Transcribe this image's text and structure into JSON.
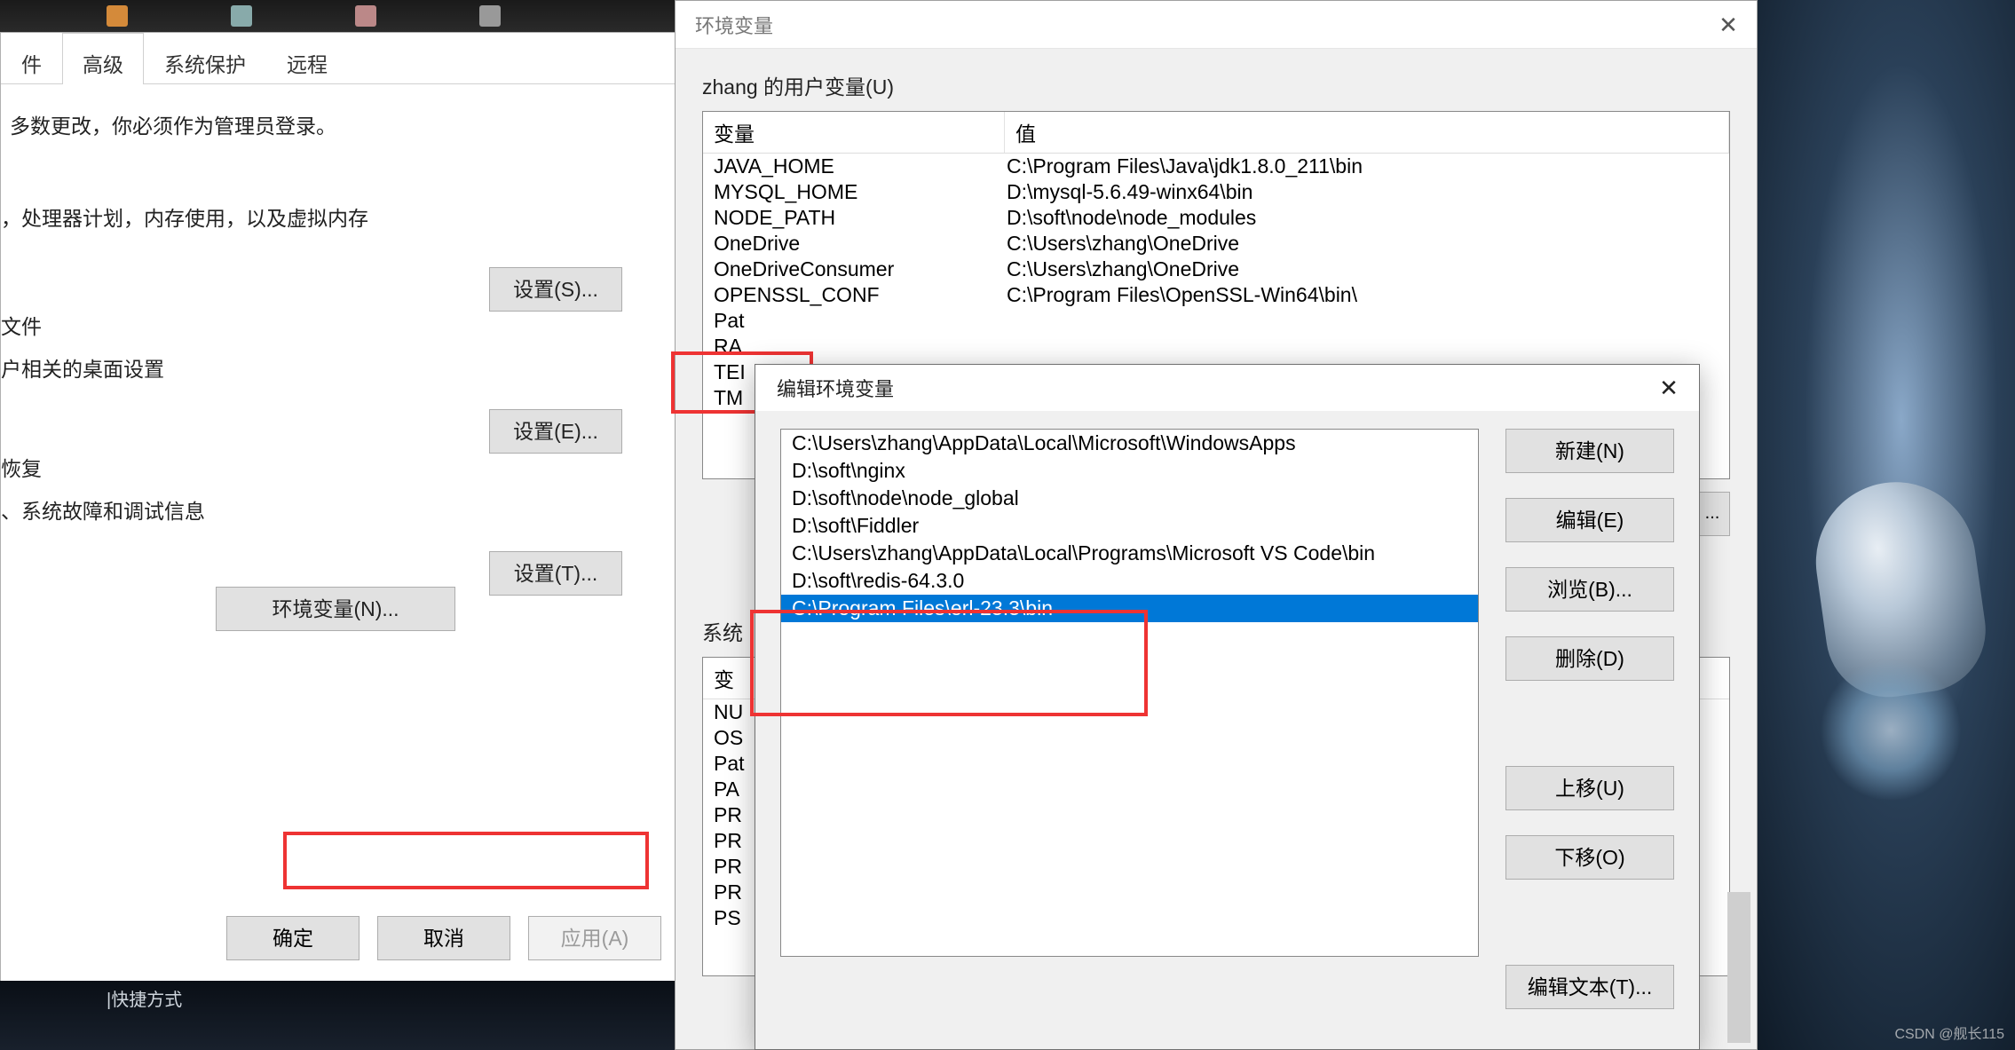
{
  "sysprops": {
    "tabs": [
      "件",
      "高级",
      "系统保护",
      "远程"
    ],
    "active_tab_index": 1,
    "admin_note": "多数更改，你必须作为管理员登录。",
    "perf_note": "，处理器计划，内存使用，以及虚拟内存",
    "perf_btn": "设置(S)...",
    "profile_title": "文件",
    "profile_note": "户相关的桌面设置",
    "profile_btn": "设置(E)...",
    "startup_title": "恢复",
    "startup_note": "、系统故障和调试信息",
    "startup_btn": "设置(T)...",
    "env_btn": "环境变量(N)...",
    "ok": "确定",
    "cancel": "取消",
    "apply": "应用(A)"
  },
  "envdialog": {
    "title": "环境变量",
    "user_label": "zhang 的用户变量(U)",
    "col_var": "变量",
    "col_val": "值",
    "user_vars": [
      {
        "name": "JAVA_HOME",
        "val": "C:\\Program Files\\Java\\jdk1.8.0_211\\bin"
      },
      {
        "name": "MYSQL_HOME",
        "val": "D:\\mysql-5.6.49-winx64\\bin"
      },
      {
        "name": "NODE_PATH",
        "val": "D:\\soft\\node\\node_modules"
      },
      {
        "name": "OneDrive",
        "val": "C:\\Users\\zhang\\OneDrive"
      },
      {
        "name": "OneDriveConsumer",
        "val": "C:\\Users\\zhang\\OneDrive"
      },
      {
        "name": "OPENSSL_CONF",
        "val": "C:\\Program Files\\OpenSSL-Win64\\bin\\"
      },
      {
        "name": "Pat",
        "val": ""
      },
      {
        "name": "RA",
        "val": ""
      },
      {
        "name": "TEI",
        "val": ""
      },
      {
        "name": "TM",
        "val": ""
      }
    ],
    "ellipsis": "...",
    "sys_label": "系统",
    "sys_col_var": "变",
    "sys_vars": [
      "NU",
      "OS",
      "Pat",
      "PA",
      "PR",
      "PR",
      "PR",
      "PR",
      "PS"
    ]
  },
  "editdialog": {
    "title": "编辑环境变量",
    "items": [
      "C:\\Users\\zhang\\AppData\\Local\\Microsoft\\WindowsApps",
      "D:\\soft\\nginx",
      "D:\\soft\\node\\node_global",
      "D:\\soft\\Fiddler",
      "C:\\Users\\zhang\\AppData\\Local\\Programs\\Microsoft VS Code\\bin",
      "D:\\soft\\redis-64.3.0",
      "C:\\Program Files\\erl-23.3\\bin"
    ],
    "selected_index": 6,
    "buttons": {
      "new": "新建(N)",
      "edit": "编辑(E)",
      "browse": "浏览(B)...",
      "delete": "删除(D)",
      "up": "上移(U)",
      "down": "下移(O)",
      "edit_text": "编辑文本(T)..."
    }
  },
  "desktop": {
    "bottom_label": "|快捷方式",
    "watermark": "CSDN @舰长115"
  }
}
